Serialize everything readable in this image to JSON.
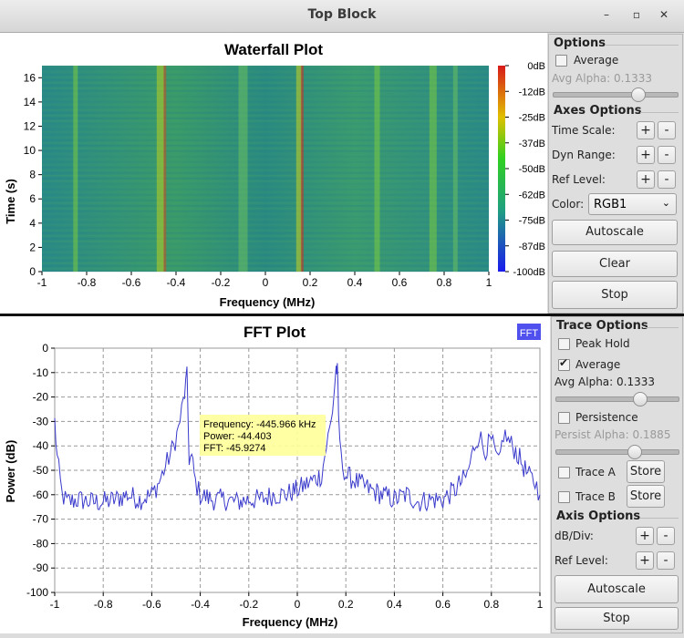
{
  "window": {
    "title": "Top Block"
  },
  "colors": {
    "trace": "#3a3acc",
    "legend_bg": "#5050ee",
    "tooltip_bg": "#ffff99"
  },
  "waterfall": {
    "title": "Waterfall Plot",
    "xlabel": "Frequency (MHz)",
    "ylabel": "Time (s)",
    "xticks": [
      "-1",
      "-0.8",
      "-0.6",
      "-0.4",
      "-0.2",
      "0",
      "0.2",
      "0.4",
      "0.6",
      "0.8",
      "1"
    ],
    "yticks": [
      "0",
      "2",
      "4",
      "6",
      "8",
      "10",
      "12",
      "14",
      "16"
    ],
    "colorbar_ticks": [
      "0dB",
      "-12dB",
      "-25dB",
      "-37dB",
      "-50dB",
      "-62dB",
      "-75dB",
      "-87dB",
      "-100dB"
    ]
  },
  "waterfall_controls": {
    "options_title": "Options",
    "average_label": "Average",
    "average_checked": false,
    "avg_alpha_label": "Avg Alpha: 0.1333",
    "avg_alpha_value": 0.1333,
    "axes_title": "Axes Options",
    "time_scale_label": "Time Scale:",
    "dyn_range_label": "Dyn Range:",
    "ref_level_label": "Ref Level:",
    "plus": "+",
    "minus": "-",
    "color_label": "Color:",
    "color_value": "RGB1",
    "autoscale": "Autoscale",
    "clear": "Clear",
    "stop": "Stop"
  },
  "fft": {
    "title": "FFT Plot",
    "legend": "FFT",
    "xlabel": "Frequency (MHz)",
    "ylabel": "Power (dB)",
    "tooltip": [
      "Frequency: -445.966 kHz",
      "Power: -44.403",
      "FFT: -45.9274"
    ]
  },
  "chart_data": {
    "type": "line",
    "title": "FFT Plot",
    "xlabel": "Frequency (MHz)",
    "ylabel": "Power (dB)",
    "xlim": [
      -1,
      1
    ],
    "ylim": [
      -100,
      0
    ],
    "xticks": [
      "-1",
      "-0.8",
      "-0.6",
      "-0.4",
      "-0.2",
      "0",
      "0.2",
      "0.4",
      "0.6",
      "0.8",
      "1"
    ],
    "yticks": [
      "0",
      "-10",
      "-20",
      "-30",
      "-40",
      "-50",
      "-60",
      "-70",
      "-80",
      "-90",
      "-100"
    ],
    "grid": true,
    "series": [
      {
        "name": "FFT",
        "x": [
          -1.0,
          -0.99,
          -0.97,
          -0.95,
          -0.9,
          -0.85,
          -0.8,
          -0.75,
          -0.7,
          -0.65,
          -0.6,
          -0.57,
          -0.55,
          -0.53,
          -0.51,
          -0.49,
          -0.47,
          -0.455,
          -0.446,
          -0.435,
          -0.42,
          -0.4,
          -0.35,
          -0.3,
          -0.25,
          -0.2,
          -0.15,
          -0.1,
          -0.05,
          0.0,
          0.05,
          0.1,
          0.12,
          0.14,
          0.15,
          0.16,
          0.165,
          0.17,
          0.18,
          0.2,
          0.25,
          0.3,
          0.35,
          0.4,
          0.45,
          0.5,
          0.55,
          0.6,
          0.65,
          0.7,
          0.73,
          0.75,
          0.77,
          0.8,
          0.83,
          0.85,
          0.87,
          0.9,
          0.95,
          0.98,
          1.0
        ],
        "values": [
          -30,
          -45,
          -60,
          -63,
          -62,
          -63,
          -63,
          -62,
          -60,
          -62,
          -60,
          -55,
          -50,
          -45,
          -40,
          -33,
          -22,
          -12,
          -45,
          -45,
          -55,
          -60,
          -62,
          -62,
          -63,
          -62,
          -62,
          -60,
          -60,
          -58,
          -55,
          -52,
          -40,
          -30,
          -20,
          -8,
          -10,
          -28,
          -45,
          -52,
          -55,
          -58,
          -60,
          -62,
          -60,
          -63,
          -62,
          -62,
          -58,
          -52,
          -40,
          -35,
          -42,
          -38,
          -48,
          -35,
          -38,
          -42,
          -52,
          -55,
          -60
        ]
      }
    ]
  },
  "fft_controls": {
    "trace_title": "Trace Options",
    "peak_hold_label": "Peak Hold",
    "peak_hold_checked": false,
    "average_label": "Average",
    "average_checked": true,
    "avg_alpha_label": "Avg Alpha: 0.1333",
    "avg_alpha_value": 0.1333,
    "persistence_label": "Persistence",
    "persistence_checked": false,
    "persist_alpha_label": "Persist Alpha: 0.1885",
    "persist_alpha_value": 0.1885,
    "trace_a_label": "Trace A",
    "trace_b_label": "Trace B",
    "store": "Store",
    "axis_title": "Axis Options",
    "db_div_label": "dB/Div:",
    "ref_level_label": "Ref Level:",
    "plus": "+",
    "minus": "-",
    "autoscale": "Autoscale",
    "stop": "Stop"
  }
}
